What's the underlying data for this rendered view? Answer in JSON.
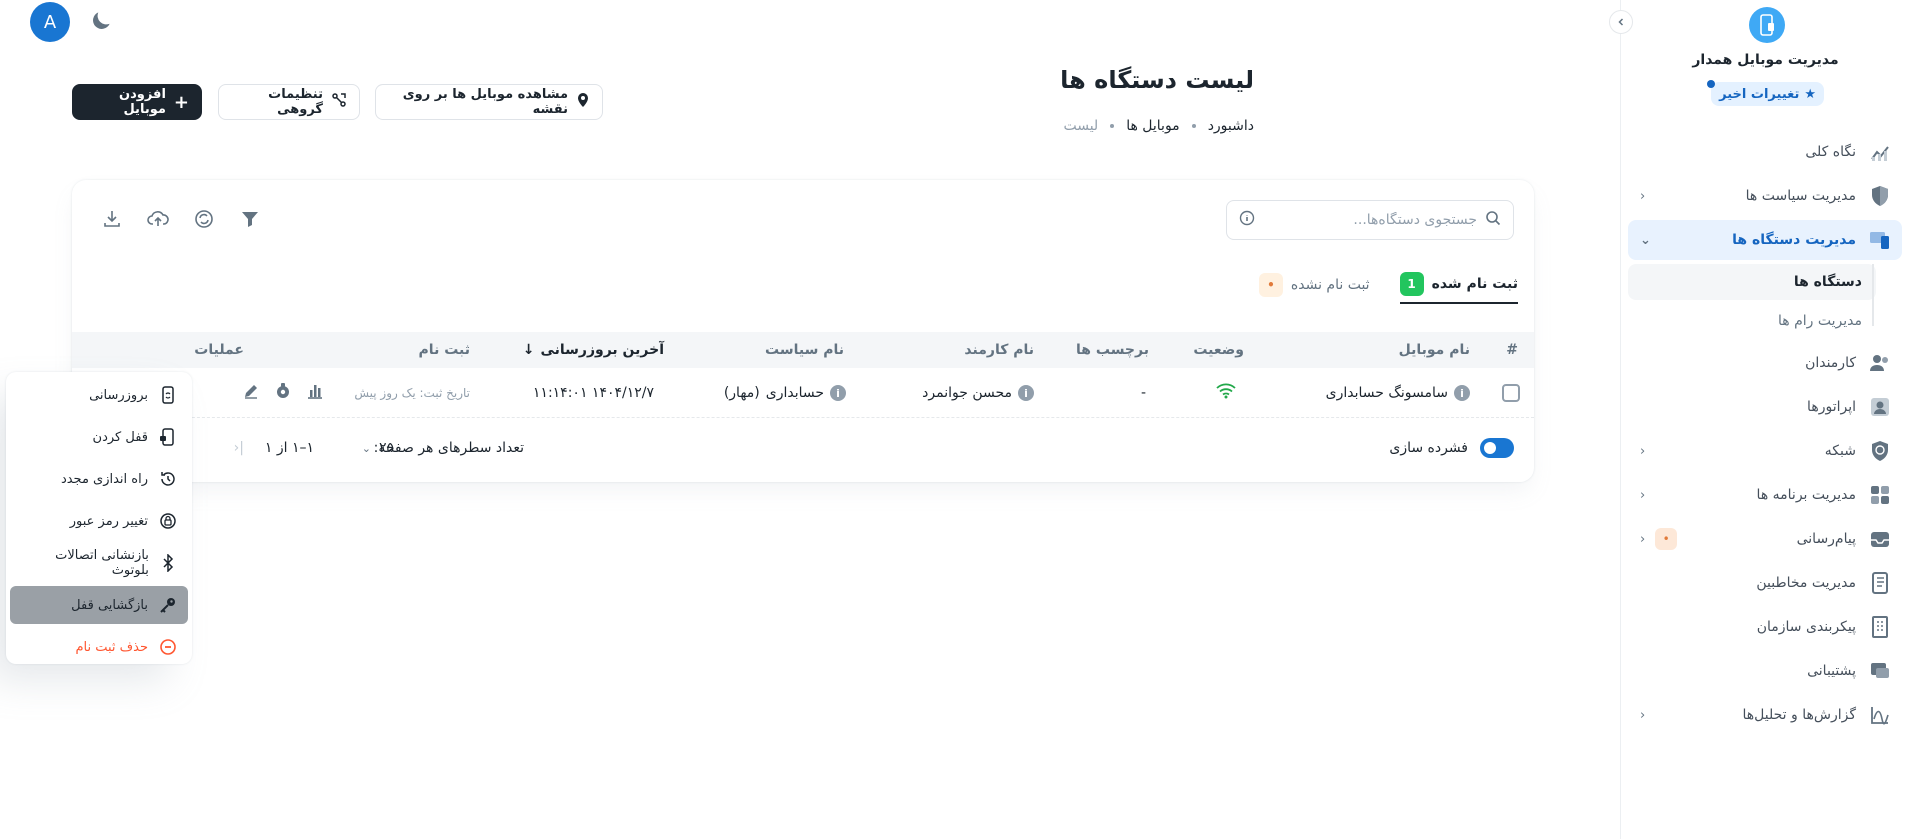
{
  "sidebar": {
    "app_name": "مدیریت موبایل همدار",
    "recent_changes": "تغییرات اخیر",
    "items": [
      {
        "label": "نگاه کلی"
      },
      {
        "label": "مدیریت سیاست ها"
      },
      {
        "label": "مدیریت دستگاه ها"
      },
      {
        "label": "کارمندان"
      },
      {
        "label": "اپراتورها"
      },
      {
        "label": "شبکه"
      },
      {
        "label": "مدیریت برنامه ها"
      },
      {
        "label": "پیام‌رسانی",
        "badge": "•"
      },
      {
        "label": "مدیریت مخاطبین"
      },
      {
        "label": "پیکربندی سازمان"
      },
      {
        "label": "پشتیبانی"
      },
      {
        "label": "گزارش‌ها و تحلیل‌ها"
      }
    ],
    "sub_items": [
      {
        "label": "دستگاه ها"
      },
      {
        "label": "مدیریت رام ها"
      }
    ]
  },
  "user": {
    "avatar_letter": "A"
  },
  "header": {
    "title": "لیست دستگاه ها",
    "breadcrumb": [
      "داشبورد",
      "موبایل ها",
      "لیست"
    ],
    "btn_map": "مشاهده موبایل ها بر روی نقشه",
    "btn_group": "تنظیمات گروهی",
    "btn_add": "افزودن موبایل"
  },
  "search": {
    "placeholder": "جستجوی دستگاه‌ها..."
  },
  "tabs": [
    {
      "label": "ثبت نام شده",
      "count": "1"
    },
    {
      "label": "ثبت نام نشده",
      "count": "•"
    }
  ],
  "table": {
    "headers": [
      "#",
      "نام موبایل",
      "وضعیت",
      "برچسب ها",
      "نام کارمند",
      "نام سیاست",
      "آخرین بروزرسانی",
      "ثبت نام",
      "عملیات"
    ],
    "row": {
      "device": "سامسونگ حسابداری",
      "tags": "-",
      "employee": "محسن جوانمرد",
      "policy": "حسابداری",
      "policy_suffix": "(مهار)",
      "last_update": "۱۴۰۴/۱۲/۷ ۱۱:۱۴:۰۱",
      "registered": "تاریخ ثبت: یک روز پیش"
    }
  },
  "footer": {
    "dense": "فشرده سازی",
    "rows_per_page_label": "تعداد سطرهای هر صفحه:",
    "rows_per_page": "۲۵",
    "range": "۱–۱ از ۱"
  },
  "menu": {
    "items": [
      {
        "label": "بروزرسانی",
        "icon": "refresh-phone-icon"
      },
      {
        "label": "قفل کردن",
        "icon": "lock-phone-icon"
      },
      {
        "label": "راه اندازی مجدد",
        "icon": "restart-icon"
      },
      {
        "label": "تغییر رمز عبور",
        "icon": "password-icon"
      },
      {
        "label": "بازنشانی اتصالات بلوتوث",
        "icon": "bluetooth-icon"
      },
      {
        "label": "بازگشایی قفل",
        "icon": "key-icon"
      },
      {
        "label": "حذف ثبت نام",
        "icon": "unenroll-icon"
      }
    ]
  },
  "colors": {
    "accent": "#1976d2",
    "dark": "#1c252e",
    "success": "#22c55e",
    "danger": "#ff5630"
  }
}
